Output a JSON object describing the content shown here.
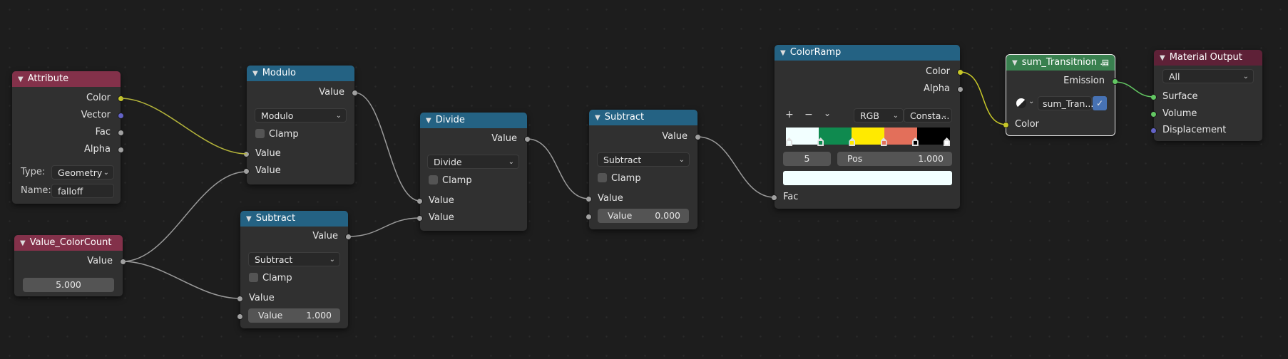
{
  "colors": {
    "input_header": "#83314a",
    "converter_header": "#246283",
    "shader_header": "#39804f",
    "output_header": "#5e2137",
    "socket_float": "#a1a1a1",
    "socket_color": "#c7c729",
    "socket_vector": "#6363c7",
    "socket_shader": "#63c763"
  },
  "nodes": {
    "attribute": {
      "title": "Attribute",
      "outputs": [
        "Color",
        "Vector",
        "Fac",
        "Alpha"
      ],
      "type_label": "Type:",
      "type_value": "Geometry",
      "name_label": "Name:",
      "name_value": "falloff"
    },
    "value_colorcount": {
      "title": "Value_ColorCount",
      "output": "Value",
      "value": "5.000"
    },
    "modulo": {
      "title": "Modulo",
      "output": "Value",
      "operation": "Modulo",
      "clamp_label": "Clamp",
      "inputs": [
        "Value",
        "Value"
      ]
    },
    "subtract1": {
      "title": "Subtract",
      "output": "Value",
      "operation": "Subtract",
      "clamp_label": "Clamp",
      "input": "Value",
      "field_label": "Value",
      "field_value": "1.000"
    },
    "divide": {
      "title": "Divide",
      "output": "Value",
      "operation": "Divide",
      "clamp_label": "Clamp",
      "inputs": [
        "Value",
        "Value"
      ]
    },
    "subtract2": {
      "title": "Subtract",
      "output": "Value",
      "operation": "Subtract",
      "clamp_label": "Clamp",
      "input": "Value",
      "field_label": "Value",
      "field_value": "0.000"
    },
    "colorramp": {
      "title": "ColorRamp",
      "outputs": [
        "Color",
        "Alpha"
      ],
      "add_icon": "+",
      "remove_icon": "−",
      "menu_icon": "chevron-down-icon",
      "color_mode": "RGB",
      "interpolation": "Consta...",
      "stops": [
        {
          "color": "#f2ffff",
          "pos": 0.0
        },
        {
          "color": "#0f8a4f",
          "pos": 0.2
        },
        {
          "color": "#ffea00",
          "pos": 0.4
        },
        {
          "color": "#e36f5a",
          "pos": 0.6
        },
        {
          "color": "#000000",
          "pos": 0.8
        },
        {
          "color": "#ffffff",
          "pos": 1.0
        }
      ],
      "active_index": "5",
      "pos_label": "Pos",
      "pos_value": "1.000",
      "active_color": "#f2ffff",
      "input": "Fac"
    },
    "sum_transition": {
      "title": "sum_Transitnion ...",
      "output": "Emission",
      "group_name": "sum_Tran...",
      "input": "Color"
    },
    "material_output": {
      "title": "Material Output",
      "target": "All",
      "inputs": [
        "Surface",
        "Volume",
        "Displacement"
      ]
    }
  }
}
